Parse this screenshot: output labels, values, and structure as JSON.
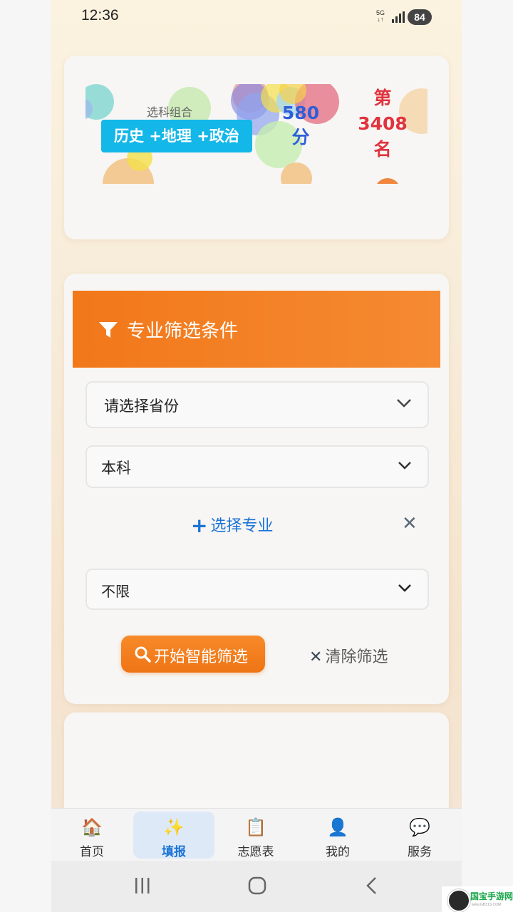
{
  "status": {
    "time": "12:36",
    "network": "5G",
    "battery": "84"
  },
  "profile": {
    "subject_title": "选科组合",
    "subjects": "历史 +地理 +政治",
    "score_value": "580",
    "score_unit": "分",
    "rank_prefix": "第",
    "rank_value": "3408",
    "rank_suffix": "名"
  },
  "filter": {
    "title": "专业筛选条件",
    "province_placeholder": "请选择省份",
    "level": "本科",
    "add_major": "选择专业",
    "limit": "不限",
    "start_label": "开始智能筛选",
    "clear_label": "清除筛选"
  },
  "tabs": [
    {
      "label": "首页",
      "icon": "house-icon"
    },
    {
      "label": "填报",
      "icon": "sparkles-icon"
    },
    {
      "label": "志愿表",
      "icon": "clipboard-icon"
    },
    {
      "label": "我的",
      "icon": "user-icon"
    },
    {
      "label": "服务",
      "icon": "chat-bubble-icon"
    }
  ],
  "watermark": {
    "text": "国宝手游网",
    "sub": "www.GB31S.COM"
  },
  "colors": {
    "accent_orange": "#f2781a",
    "accent_blue": "#1a73d6",
    "badge_cyan": "#13b7e8",
    "rank_red": "#e0343e",
    "score_blue": "#2f5fd8"
  }
}
